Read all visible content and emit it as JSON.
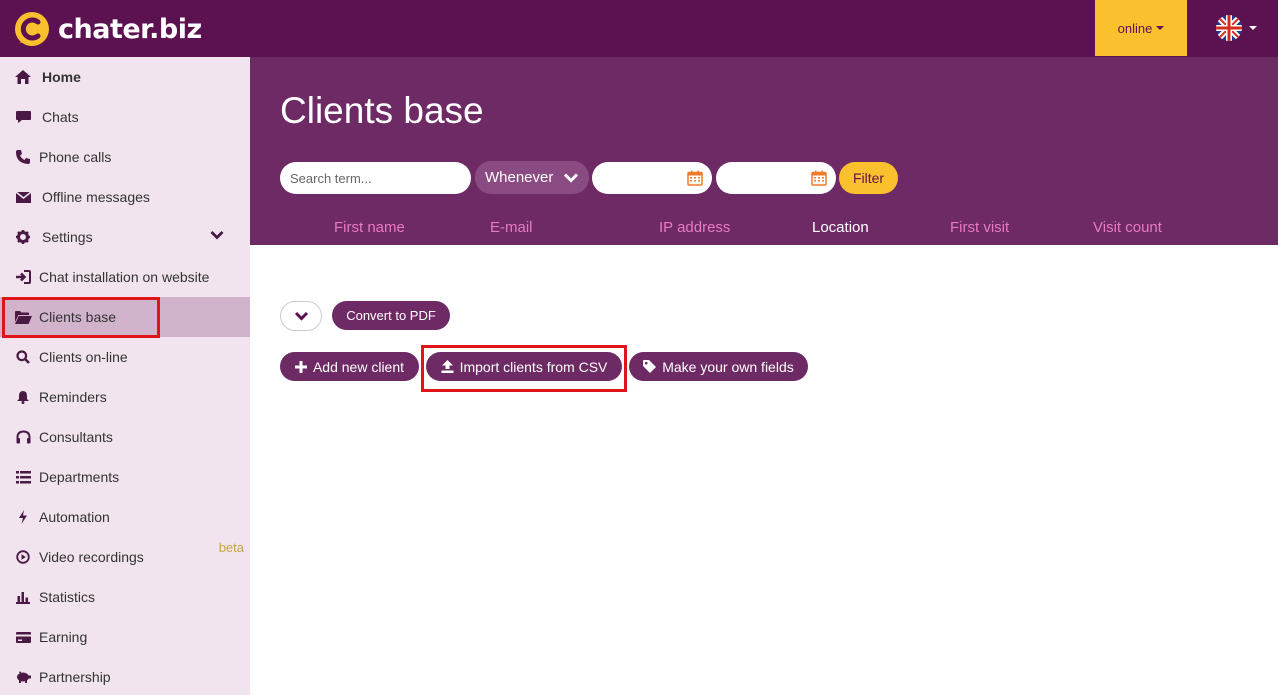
{
  "brand": {
    "name": "chater.biz",
    "primary": "#5c1150",
    "header": "#6e2a65",
    "accent": "#fbc02d",
    "highlight": "#e0141b"
  },
  "topbar": {
    "status_label": "online",
    "language_icon": "uk-flag-icon"
  },
  "sidebar": {
    "items": [
      {
        "label": "Home",
        "icon": "home-icon"
      },
      {
        "label": "Chats",
        "icon": "chat-icon"
      },
      {
        "label": "Phone calls",
        "icon": "phone-icon"
      },
      {
        "label": "Offline messages",
        "icon": "envelope-icon"
      },
      {
        "label": "Settings",
        "icon": "gear-icon"
      },
      {
        "label": "Chat installation on website",
        "icon": "sign-in-icon"
      },
      {
        "label": "Clients base",
        "icon": "folder-open-icon"
      },
      {
        "label": "Clients on-line",
        "icon": "search-icon"
      },
      {
        "label": "Reminders",
        "icon": "bell-icon"
      },
      {
        "label": "Consultants",
        "icon": "headphones-icon"
      },
      {
        "label": "Departments",
        "icon": "list-icon"
      },
      {
        "label": "Automation",
        "icon": "bolt-icon"
      },
      {
        "label": "Video recordings",
        "icon": "play-circle-icon",
        "badge": "beta"
      },
      {
        "label": "Statistics",
        "icon": "bar-chart-icon"
      },
      {
        "label": "Earning",
        "icon": "credit-card-icon"
      },
      {
        "label": "Partnership",
        "icon": "piggy-bank-icon"
      }
    ]
  },
  "main": {
    "title": "Clients base",
    "search_placeholder": "Search term...",
    "period_label": "Whenever",
    "filter_label": "Filter",
    "columns": [
      "First name",
      "E-mail",
      "IP address",
      "Location",
      "First visit",
      "Visit count"
    ]
  },
  "actions": {
    "convert_pdf": "Convert to PDF",
    "add_client": "Add new client",
    "import_csv": "Import clients from CSV",
    "own_fields": "Make your own fields"
  }
}
